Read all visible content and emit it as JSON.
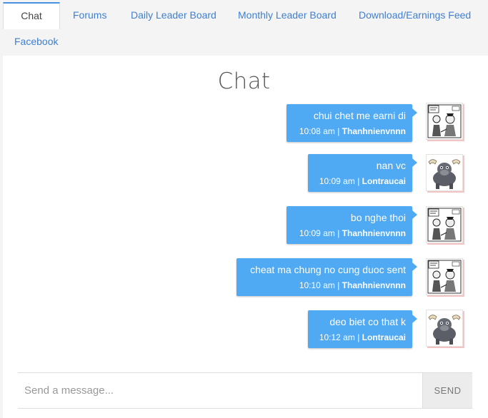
{
  "tabs": [
    {
      "label": "Chat"
    },
    {
      "label": "Forums"
    },
    {
      "label": "Daily Leader Board"
    },
    {
      "label": "Monthly Leader Board"
    },
    {
      "label": "Download/Earnings Feed"
    },
    {
      "label": "Facebook"
    }
  ],
  "chat": {
    "title": "Chat",
    "messages": [
      {
        "text": "chui chet me earni di",
        "time": "10:08 am",
        "user": "Thanhnienvnnn",
        "avatar": "comic-avatar-icon"
      },
      {
        "text": "nan vc",
        "time": "10:09 am",
        "user": "Lontraucai",
        "avatar": "buffalo-avatar-icon"
      },
      {
        "text": "bo nghe thoi",
        "time": "10:09 am",
        "user": "Thanhnienvnnn",
        "avatar": "comic-avatar-icon"
      },
      {
        "text": "cheat ma chung no cung duoc sent",
        "time": "10:10 am",
        "user": "Thanhnienvnnn",
        "avatar": "comic-avatar-icon"
      },
      {
        "text": "deo biet co that k",
        "time": "10:12 am",
        "user": "Lontraucai",
        "avatar": "buffalo-avatar-icon"
      }
    ],
    "separator": " | ",
    "composer": {
      "placeholder": "Send a message...",
      "send_label": "SEND"
    }
  },
  "colors": {
    "accent": "#4fa9f3",
    "link": "#3f7fd1",
    "tab_border": "#4a90e2"
  }
}
